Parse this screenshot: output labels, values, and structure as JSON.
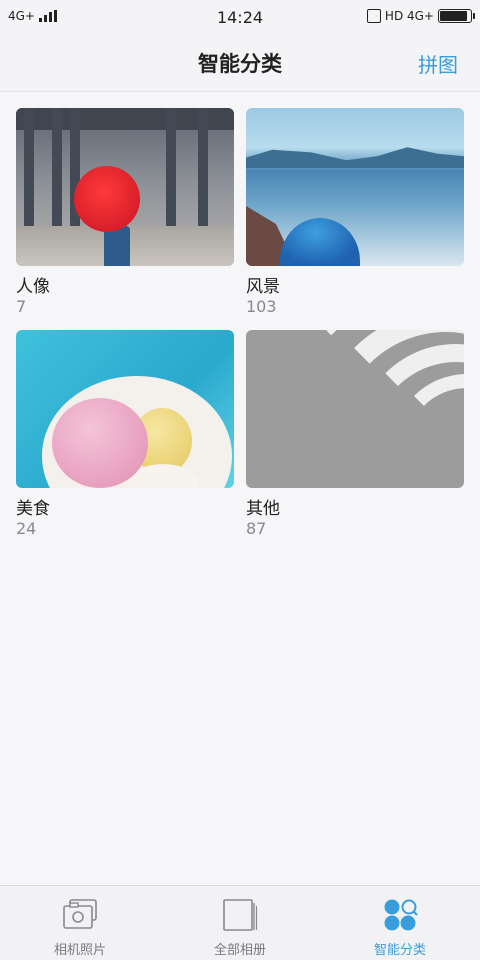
{
  "status_bar": {
    "network_left": "4G+",
    "time": "14:24",
    "network_right": "HD 4G+"
  },
  "header": {
    "title": "智能分类",
    "action_label": "拼图"
  },
  "categories": [
    {
      "label": "人像",
      "count": "7"
    },
    {
      "label": "风景",
      "count": "103"
    },
    {
      "label": "美食",
      "count": "24"
    },
    {
      "label": "其他",
      "count": "87"
    }
  ],
  "bottom_nav": [
    {
      "label": "相机照片",
      "icon": "camera-photos-icon",
      "active": false
    },
    {
      "label": "全部相册",
      "icon": "albums-icon",
      "active": false
    },
    {
      "label": "智能分类",
      "icon": "smart-category-icon",
      "active": true
    }
  ],
  "colors": {
    "accent": "#3a9ddb",
    "background": "#f6f6f8",
    "label_gray": "#8a8a8e"
  }
}
